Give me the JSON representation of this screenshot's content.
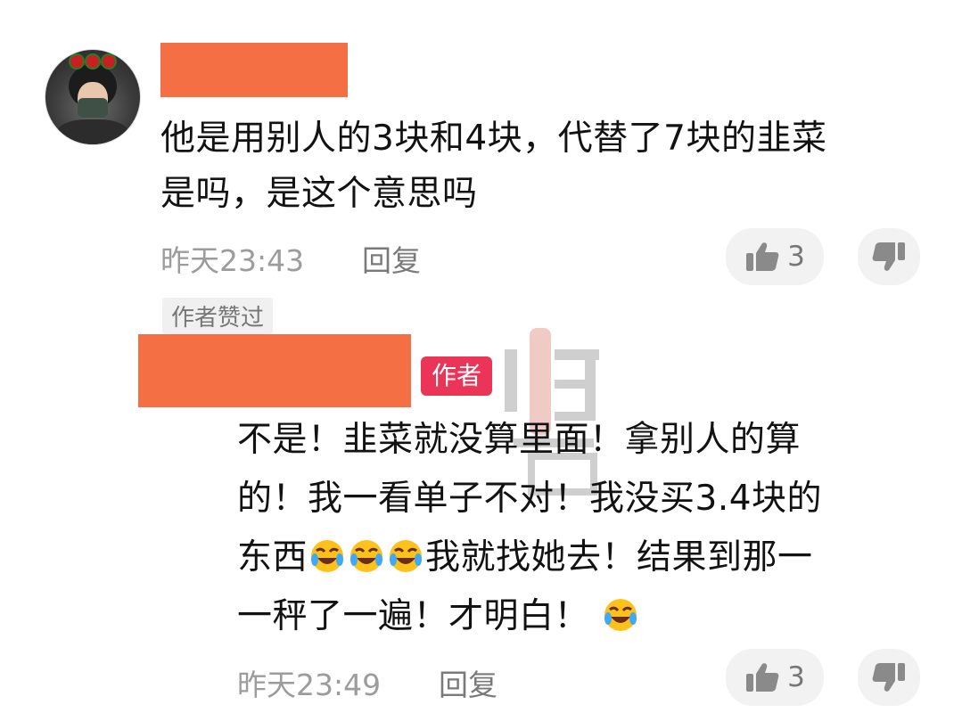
{
  "comment1": {
    "text_line1": "他是用别人的3块和4块，代替了7块的韭菜",
    "text_line2": "是吗，是这个意思吗",
    "time": "昨天23:43",
    "reply_label": "回复",
    "like_count": "3",
    "tag": "作者赞过"
  },
  "comment2": {
    "author_badge": "作者",
    "line1": "不是！韭菜就没算里面！拿别人的算",
    "line2": "的！我一看单子不对！我没买3.4块的",
    "line3_a": "东西",
    "line3_b": "我就找她去！结果到那一",
    "line4": "一秤了一遍！才明白！",
    "time": "昨天23:49",
    "reply_label": "回复",
    "like_count": "3"
  },
  "icons": {
    "like": "thumbs-up-icon",
    "dislike": "thumbs-down-icon",
    "emoji": "laugh-cry-emoji"
  },
  "colors": {
    "redaction": "#f56f45",
    "author_badge": "#ea3559",
    "meta_text": "#9c9c9c"
  }
}
